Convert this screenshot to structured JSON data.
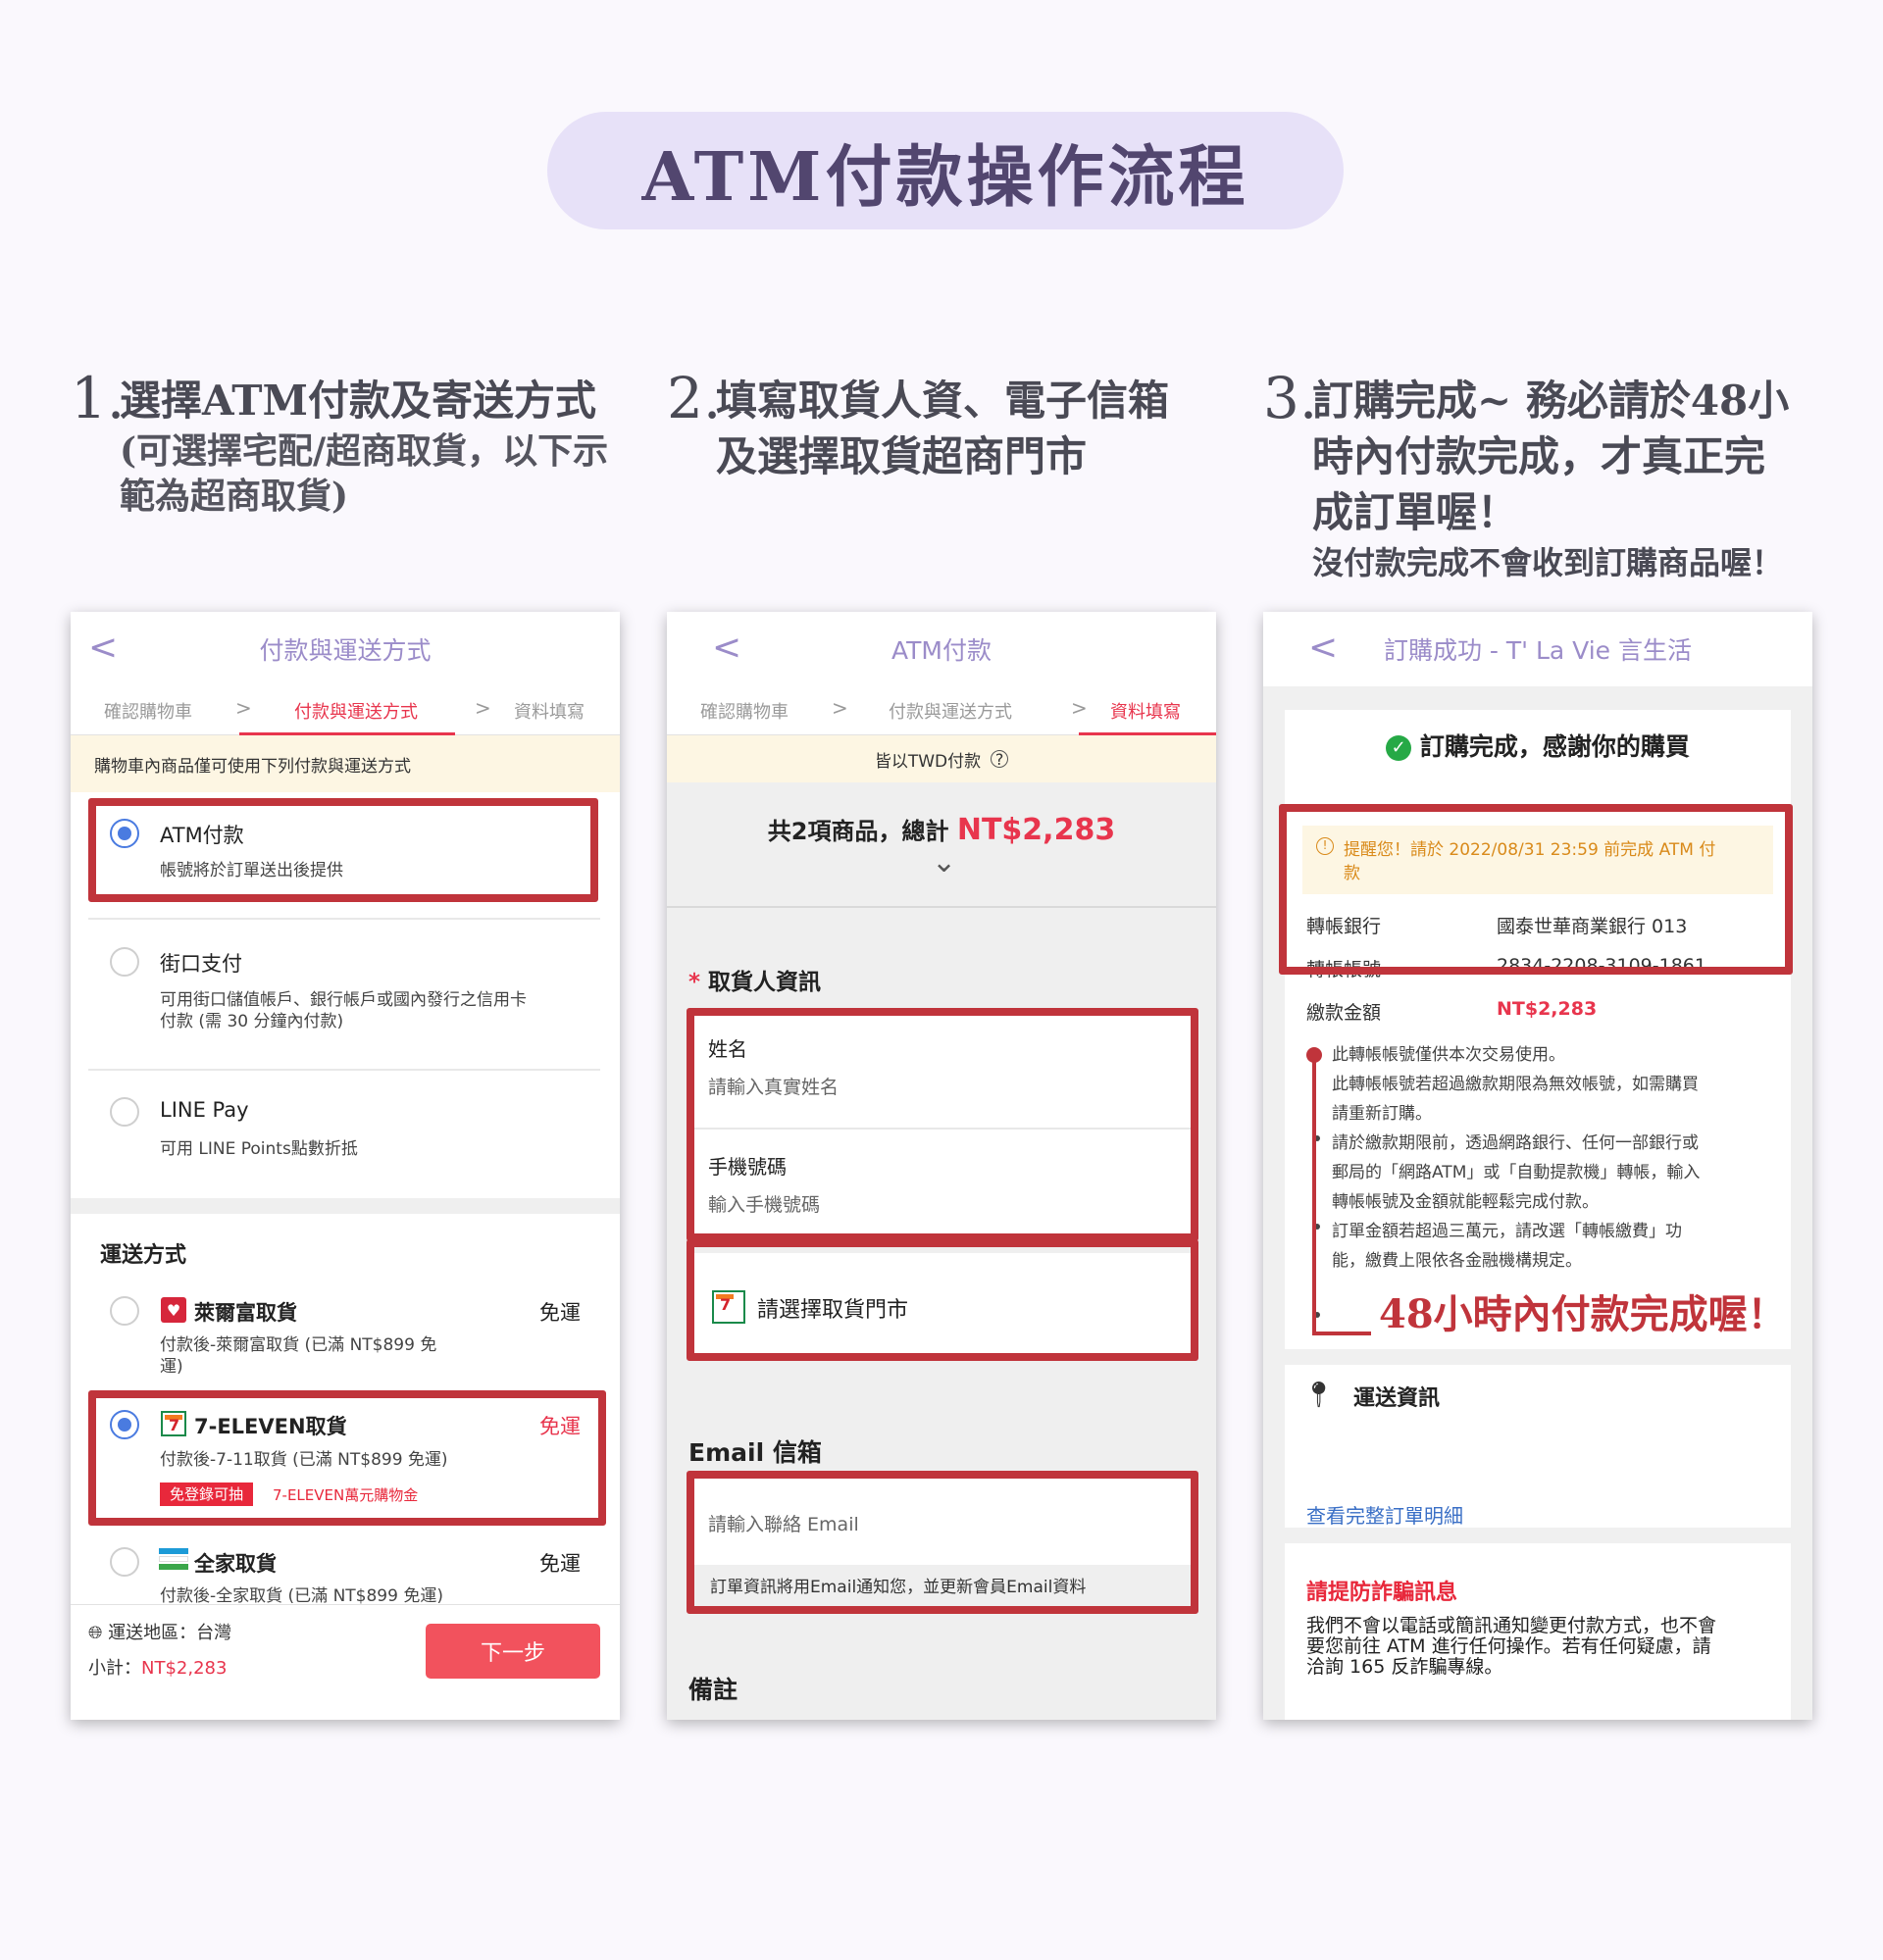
{
  "title": "ATM付款操作流程",
  "steps": [
    {
      "num": "1.",
      "head": "選擇ATM付款及寄送方式",
      "sub1": "(可選擇宅配/超商取貨，以下示",
      "sub2": "範為超商取貨)"
    },
    {
      "num": "2.",
      "head1": "填寫取貨人資、電子信箱",
      "head2": "及選擇取貨超商門市"
    },
    {
      "num": "3.",
      "head1": "訂購完成~ 務必請於48小",
      "head2": "時內付款完成，才真正完",
      "head3": "成訂單喔！",
      "sub": "沒付款完成不會收到訂購商品喔！"
    }
  ],
  "screen1": {
    "back": "<",
    "title": "付款與運送方式",
    "crumbs": [
      "確認購物車",
      "付款與運送方式",
      "資料填寫"
    ],
    "chevron": ">",
    "notice": "購物車內商品僅可使用下列付款與運送方式",
    "payments": [
      {
        "name": "ATM付款",
        "desc": "帳號將於訂單送出後提供"
      },
      {
        "name": "街口支付",
        "desc1": "可用街口儲值帳戶、銀行帳戶或國內發行之信用卡",
        "desc2": "付款 (需 30 分鐘內付款)"
      },
      {
        "name": "LINE Pay",
        "desc": "可用 LINE Points點數折抵"
      }
    ],
    "shipping_title": "運送方式",
    "shipping": [
      {
        "name": "萊爾富取貨",
        "fee": "免運",
        "desc1": "付款後-萊爾富取貨 (已滿 NT$899 免",
        "desc2": "運)"
      },
      {
        "name": "7-ELEVEN取貨",
        "fee": "免運",
        "desc": "付款後-7-11取貨 (已滿 NT$899 免運)",
        "badge": "免登錄可抽",
        "promo": "7-ELEVEN萬元購物金"
      },
      {
        "name": "全家取貨",
        "fee": "免運",
        "desc": "付款後-全家取貨 (已滿 NT$899 免運)"
      }
    ],
    "region": "運送地區：台灣",
    "subtotal_label": "小計：",
    "subtotal_value": "NT$2,283",
    "next": "下一步"
  },
  "screen2": {
    "back": "<",
    "title": "ATM付款",
    "crumbs": [
      "確認購物車",
      "付款與運送方式",
      "資料填寫"
    ],
    "chevron": ">",
    "notice": "皆以TWD付款",
    "summary_label": "共2項商品，總計",
    "summary_value": "NT$2,283",
    "expand": "⌄",
    "required": "*",
    "receiver_title": "取貨人資訊",
    "name_label": "姓名",
    "name_ph": "請輸入真實姓名",
    "phone_label": "手機號碼",
    "phone_ph": "輸入手機號碼",
    "store": "請選擇取貨門市",
    "email_title": "Email 信箱",
    "email_ph": "請輸入聯絡 Email",
    "email_note": "訂單資訊將用Email通知您，並更新會員Email資料",
    "memo_title": "備註"
  },
  "screen3": {
    "back": "<",
    "title": "訂購成功 - T' La Vie 言生活",
    "done": "訂購完成，感謝你的購買",
    "remind": "提醒您！請於 2022/08/31 23:59 前完成 ATM 付",
    "remind2": "款",
    "bank_label": "轉帳銀行",
    "bank_value": "國泰世華商業銀行 013",
    "acct_label": "轉帳帳號",
    "acct_value": "2834-2208-3109-1861",
    "amount_label": "繳款金額",
    "amount_value": "NT$2,283",
    "bullets": [
      "此轉帳帳號僅供本次交易使用。",
      "此轉帳帳號若超過繳款期限為無效帳號，如需購買",
      "請重新訂購。",
      "請於繳款期限前，透過網路銀行、任何一部銀行或",
      "郵局的「網路ATM」或「自動提款機」轉帳，輸入",
      "轉帳帳號及金額就能輕鬆完成付款。",
      "訂單金額若超過三萬元，請改選「轉帳繳費」功",
      "能，繳費上限依各金融機構規定。"
    ],
    "annotation": "48小時內付款完成喔！",
    "ship_title": "運送資訊",
    "detail_link": "查看完整訂單明細",
    "fraud_title": "請提防詐騙訊息",
    "fraud_lines": [
      "我們不會以電話或簡訊通知變更付款方式，也不會",
      "要您前往 ATM 進行任何操作。若有任何疑慮，請",
      "洽詢 165 反詐騙專線。"
    ]
  },
  "colors": {
    "accent": "#9b8cc9",
    "red": "#e8354d",
    "highlight_box": "#c0343b",
    "pill": "#e7e1f8"
  }
}
